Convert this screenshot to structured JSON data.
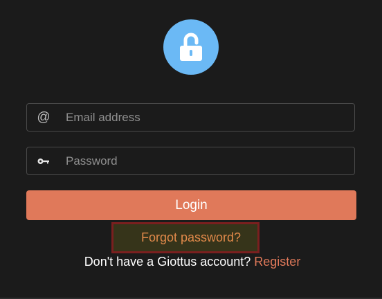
{
  "colors": {
    "background": "#1b1b1b",
    "lock_circle": "#6bb9f5",
    "accent": "#e0795a",
    "forgot_text": "#e0894a",
    "highlight_border": "#7a1f1f",
    "highlight_fill": "#36341a"
  },
  "logo": {
    "icon": "lock-icon"
  },
  "form": {
    "email": {
      "icon_glyph": "@",
      "icon": "at-sign-icon",
      "placeholder": "Email address",
      "value": ""
    },
    "password": {
      "icon": "key-icon",
      "placeholder": "Password",
      "value": ""
    },
    "login_label": "Login",
    "forgot_label": "Forgot password?",
    "register_prompt": "Don't have a Giottus account?",
    "register_label": "Register"
  }
}
